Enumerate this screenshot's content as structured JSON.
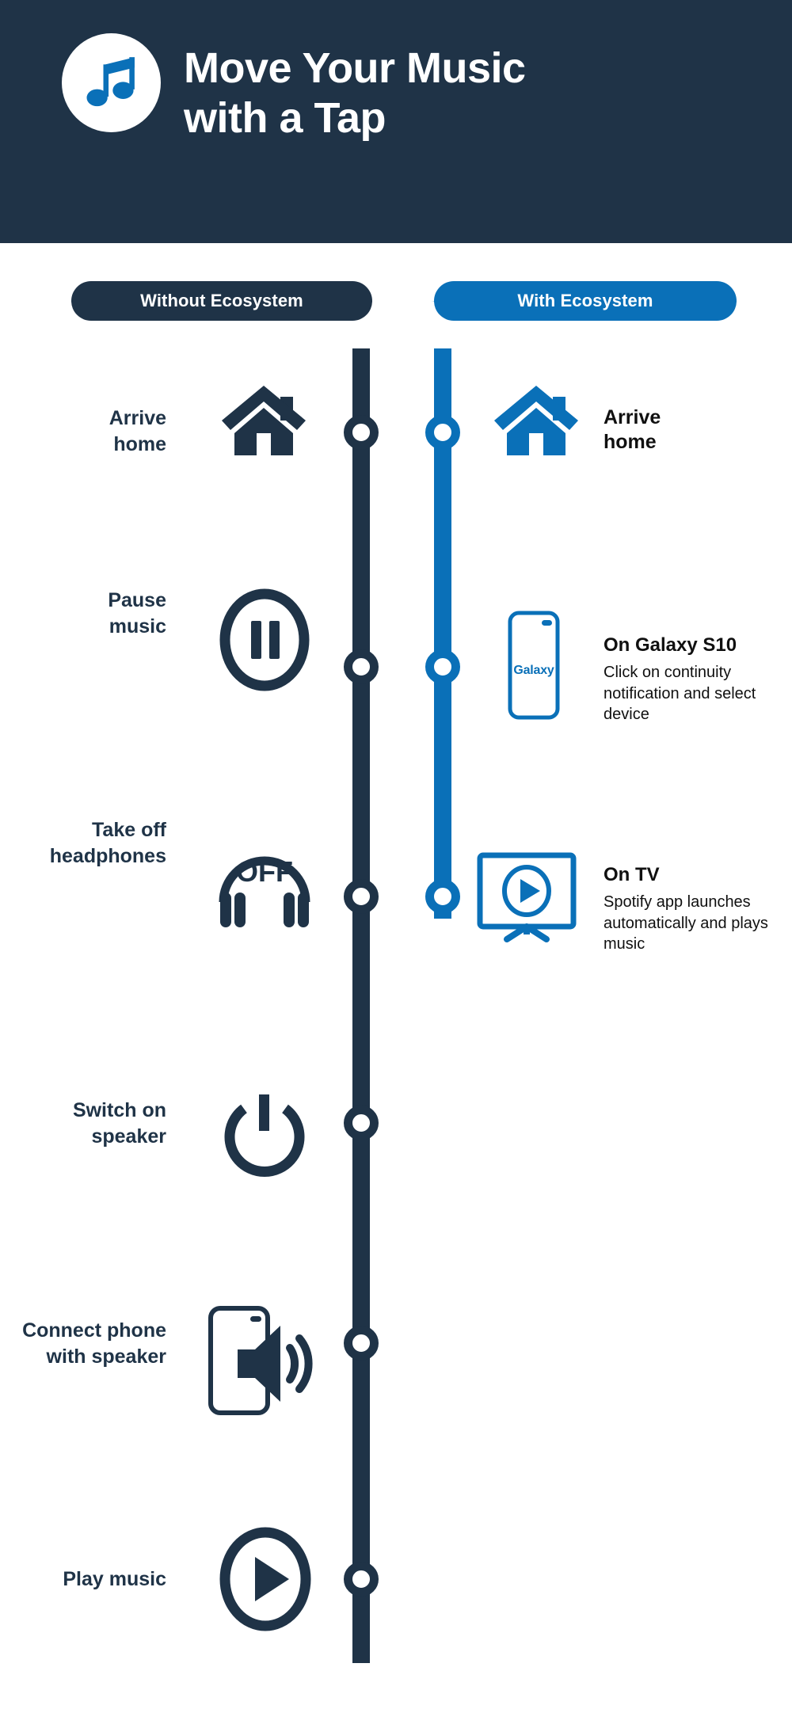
{
  "colors": {
    "navy": "#1f3347",
    "blue": "#0a70b8",
    "white": "#ffffff",
    "text_black": "#101010"
  },
  "header": {
    "title_line1": "Move Your Music",
    "title_line2": "with a Tap",
    "badge_icon": "music-note-icon"
  },
  "columns": {
    "left": {
      "label": "Without Ecosystem"
    },
    "right": {
      "label": "With Ecosystem"
    }
  },
  "left_steps": [
    {
      "label_line1": "Arrive",
      "label_line2": "home",
      "icon": "house-icon"
    },
    {
      "label_line1": "Pause",
      "label_line2": "music",
      "icon": "pause-circle-icon"
    },
    {
      "label_line1": "Take off",
      "label_line2": "headphones",
      "icon": "headphones-off-icon",
      "icon_text": "OFF"
    },
    {
      "label_line1": "Switch on",
      "label_line2": "speaker",
      "icon": "power-icon"
    },
    {
      "label_line1": "Connect phone",
      "label_line2": "with speaker",
      "icon": "phone-speaker-icon"
    },
    {
      "label_line1": "Play music",
      "label_line2": "",
      "icon": "play-circle-icon"
    }
  ],
  "right_steps": [
    {
      "icon": "house-icon",
      "title": "Arrive",
      "title_line2": "home",
      "body": "",
      "style": "simple"
    },
    {
      "icon": "galaxy-phone-icon",
      "icon_text": "Galaxy",
      "title": "On Galaxy S10",
      "body": "Click on continuity notification and select device",
      "style": "detail"
    },
    {
      "icon": "tv-play-icon",
      "title": "On TV",
      "body": "Spotify app launches automatically and plays music",
      "style": "detail"
    }
  ]
}
